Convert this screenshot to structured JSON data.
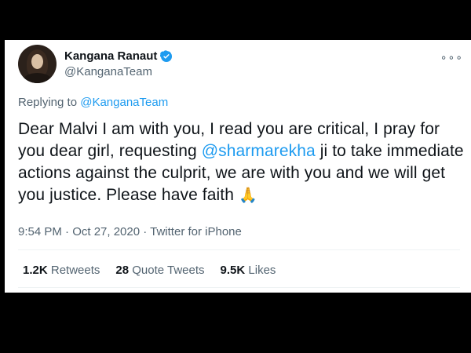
{
  "tweet": {
    "display_name": "Kangana Ranaut",
    "handle": "@KanganaTeam",
    "more_label": "∘∘∘",
    "replying_prefix": "Replying to ",
    "replying_to": "@KanganaTeam",
    "text_part1": "Dear Malvi I am with you, I read you are critical, I pray for you dear girl, requesting ",
    "text_mention": "@sharmarekha",
    "text_part2": " ji to take immediate actions against the culprit, we are with you and we will get you justice. Please have faith ",
    "emoji": "🙏",
    "timestamp": "9:54 PM · Oct 27, 2020 · Twitter for iPhone"
  },
  "stats": {
    "retweets_count": "1.2K",
    "retweets_label": "Retweets",
    "quotes_count": "28",
    "quotes_label": "Quote Tweets",
    "likes_count": "9.5K",
    "likes_label": "Likes"
  },
  "colors": {
    "accent": "#1d9bf0",
    "text": "#0f1419",
    "secondary": "#536471"
  },
  "icons": {
    "verified": "verified-badge-icon",
    "more": "more-options-icon"
  }
}
